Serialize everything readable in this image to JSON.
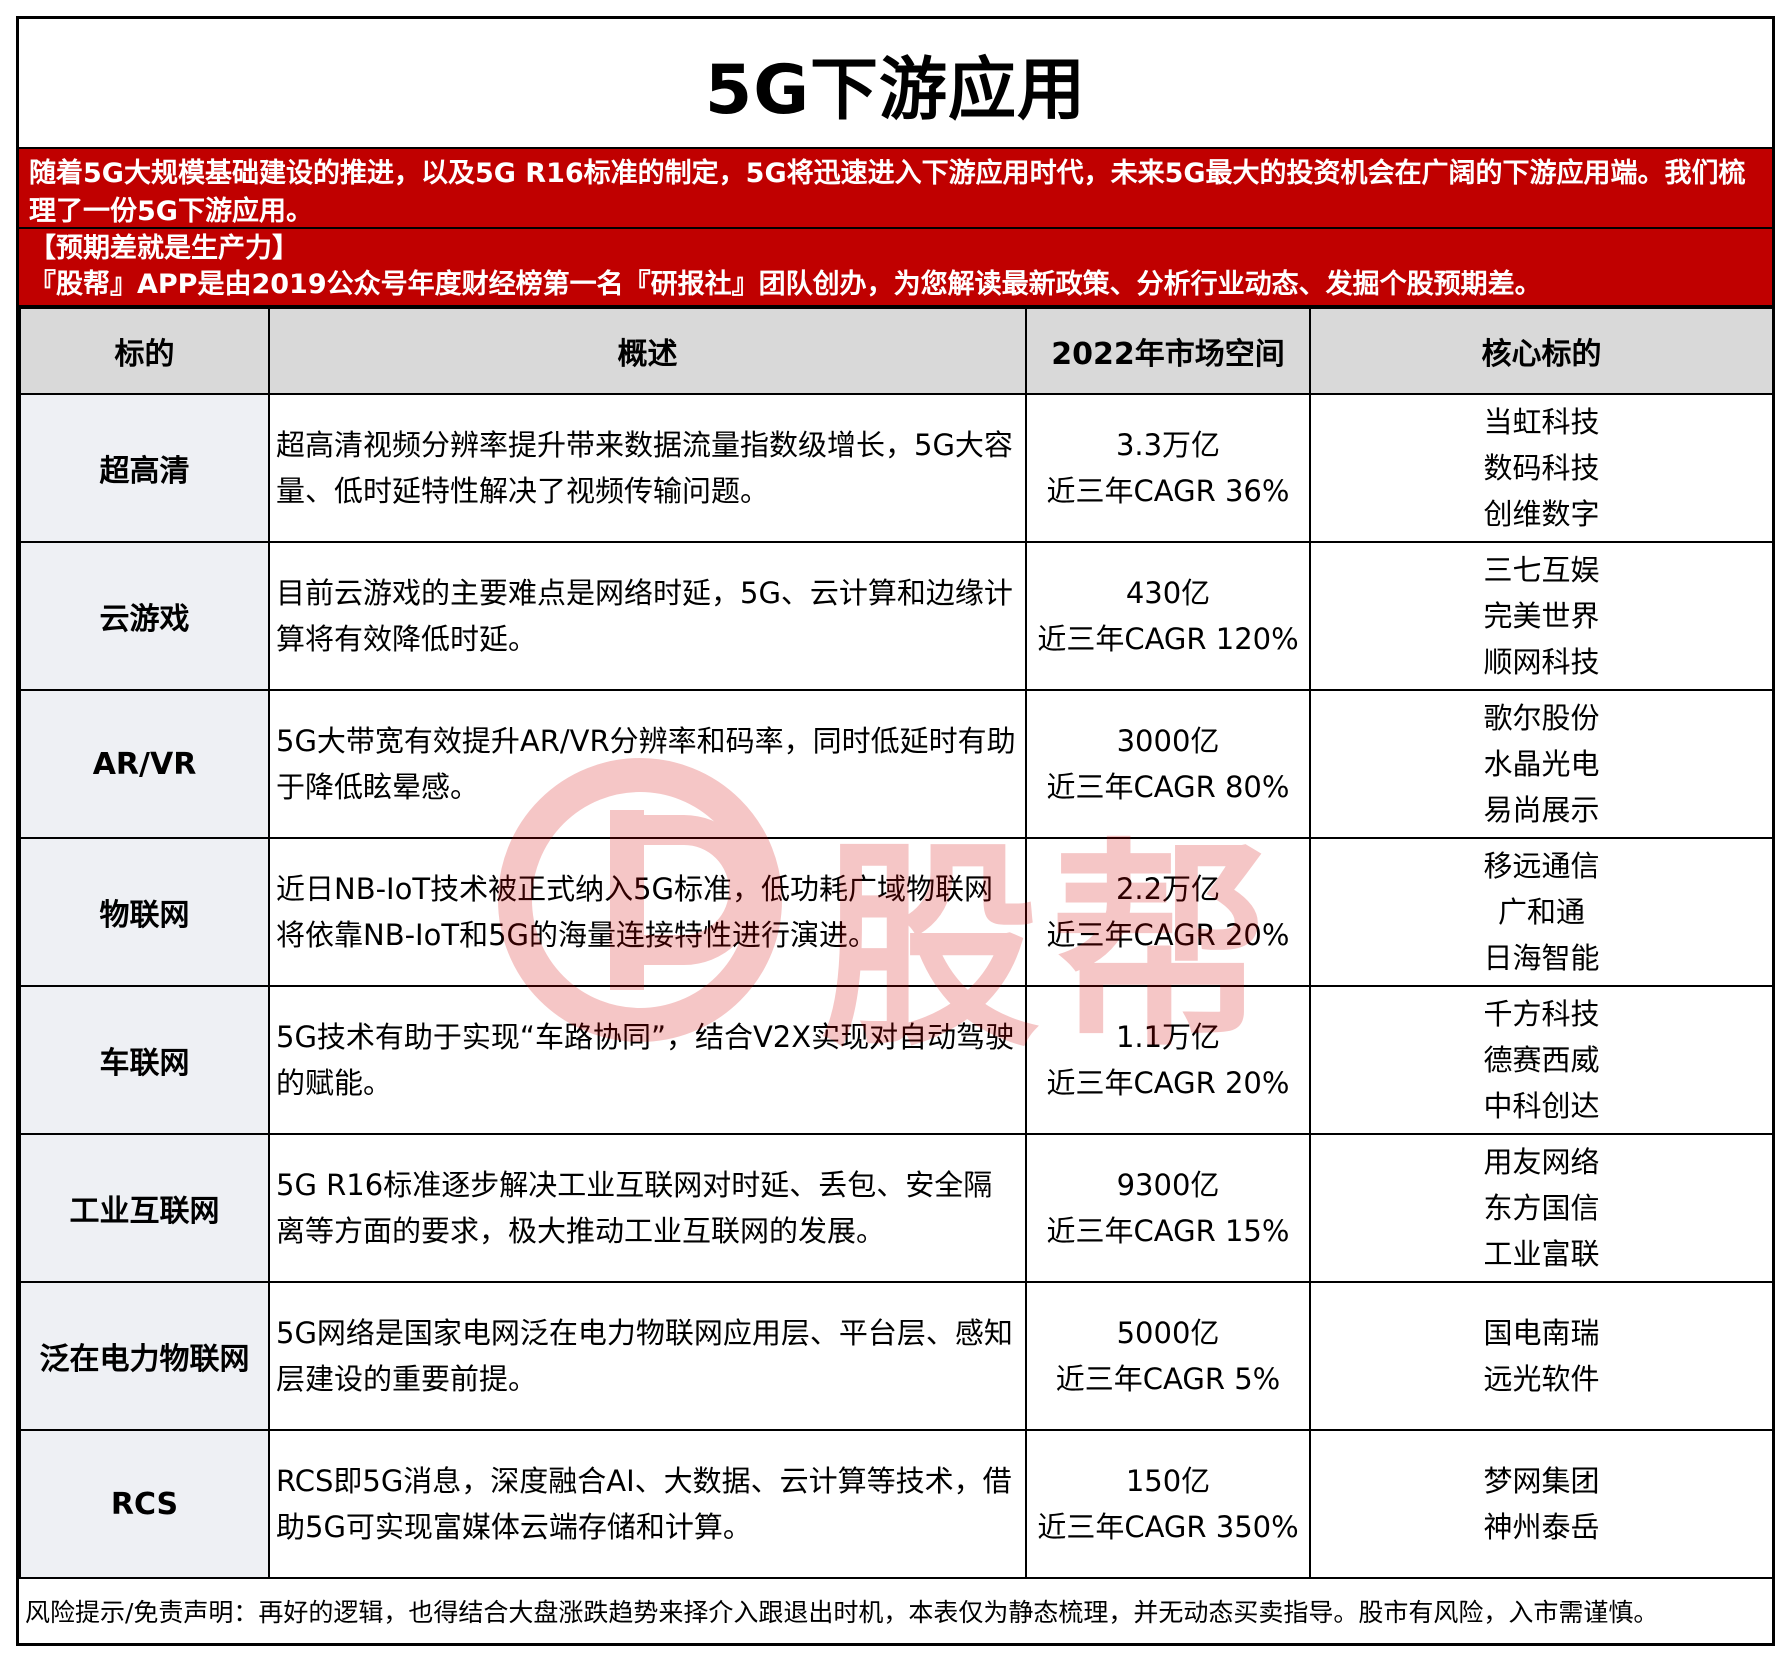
{
  "title": "5G下游应用",
  "intro": "随着5G大规模基础建设的推进，以及5G R16标准的制定，5G将迅速进入下游应用时代，未来5G最大的投资机会在广阔的下游应用端。我们梳理了一份5G下游应用。",
  "promo": {
    "line1": "【预期差就是生产力】",
    "line2": "『股帮』APP是由2019公众号年度财经榜第一名『研报社』团队创办，为您解读最新政策、分析行业动态、发掘个股预期差。"
  },
  "table": {
    "headers": [
      "标的",
      "概述",
      "2022年市场空间",
      "核心标的"
    ],
    "rows": [
      {
        "name": "超高清",
        "desc": "超高清视频分辨率提升带来数据流量指数级增长，5G大容量、低时延特性解决了视频传输问题。",
        "market": "3.3万亿",
        "cagr": "近三年CAGR 36%",
        "targets": [
          "当虹科技",
          "数码科技",
          "创维数字"
        ]
      },
      {
        "name": "云游戏",
        "desc": "目前云游戏的主要难点是网络时延，5G、云计算和边缘计算将有效降低时延。",
        "market": "430亿",
        "cagr": "近三年CAGR 120%",
        "targets": [
          "三七互娱",
          "完美世界",
          "顺网科技"
        ]
      },
      {
        "name": "AR/VR",
        "desc": "5G大带宽有效提升AR/VR分辨率和码率，同时低延时有助于降低眩晕感。",
        "market": "3000亿",
        "cagr": "近三年CAGR 80%",
        "targets": [
          "歌尔股份",
          "水晶光电",
          "易尚展示"
        ]
      },
      {
        "name": "物联网",
        "desc": "近日NB-IoT技术被正式纳入5G标准，低功耗广域物联网将依靠NB-IoT和5G的海量连接特性进行演进。",
        "market": "2.2万亿",
        "cagr": "近三年CAGR 20%",
        "targets": [
          "移远通信",
          "广和通",
          "日海智能"
        ]
      },
      {
        "name": "车联网",
        "desc": "5G技术有助于实现“车路协同”，结合V2X实现对自动驾驶的赋能。",
        "market": "1.1万亿",
        "cagr": "近三年CAGR 20%",
        "targets": [
          "千方科技",
          "德赛西威",
          "中科创达"
        ]
      },
      {
        "name": "工业互联网",
        "desc": "5G R16标准逐步解决工业互联网对时延、丢包、安全隔离等方面的要求，极大推动工业互联网的发展。",
        "market": "9300亿",
        "cagr": "近三年CAGR 15%",
        "targets": [
          "用友网络",
          "东方国信",
          "工业富联"
        ]
      },
      {
        "name": "泛在电力物联网",
        "desc": "5G网络是国家电网泛在电力物联网应用层、平台层、感知层建设的重要前提。",
        "market": "5000亿",
        "cagr": "近三年CAGR 5%",
        "targets": [
          "国电南瑞",
          "远光软件"
        ]
      },
      {
        "name": "RCS",
        "desc": "RCS即5G消息，深度融合AI、大数据、云计算等技术，借助5G可实现富媒体云端存储和计算。",
        "market": "150亿",
        "cagr": "近三年CAGR 350%",
        "targets": [
          "梦网集团",
          "神州泰岳"
        ]
      }
    ]
  },
  "footer": "风险提示/免责声明：再好的逻辑，也得结合大盘涨跌趋势来择介入跟退出时机，本表仅为静态梳理，并无动态买卖指导。股市有风险，入市需谨慎。",
  "watermark": {
    "text": "股帮",
    "color": "#d30000",
    "icon": "gb-logo-icon"
  },
  "colors": {
    "banner": "#c00000",
    "header_bg": "#d9d9d9",
    "name_bg": "#eef0f4"
  }
}
